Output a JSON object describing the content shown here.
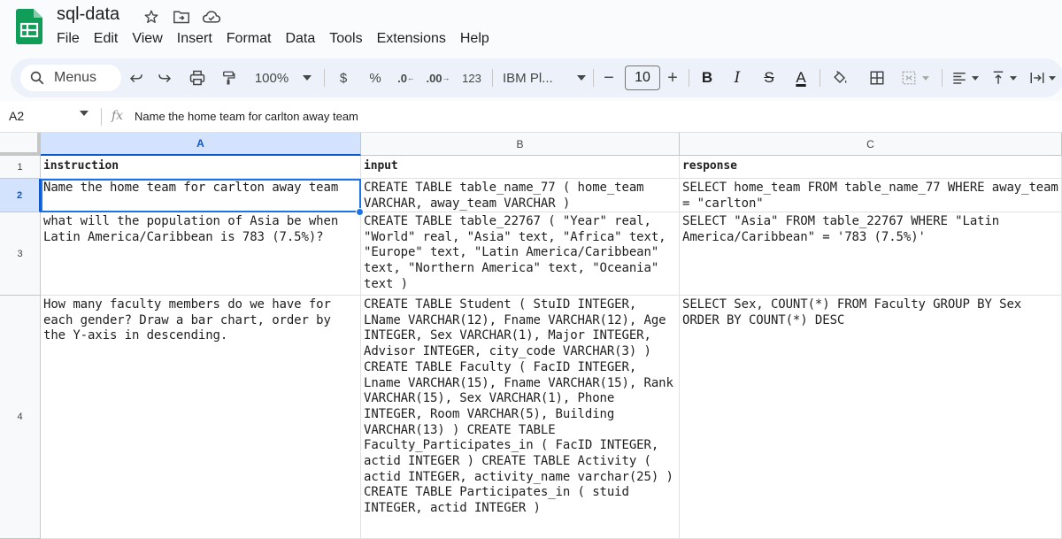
{
  "app": {
    "doc_title": "sql-data",
    "title_icons": [
      "star-icon",
      "move-to-folder-icon",
      "cloud-saved-icon"
    ],
    "menu": [
      "File",
      "Edit",
      "View",
      "Insert",
      "Format",
      "Data",
      "Tools",
      "Extensions",
      "Help"
    ]
  },
  "toolbar": {
    "menus_label": "Menus",
    "zoom": "100%",
    "currency": "$",
    "percent": "%",
    "decrease_decimal": ".0",
    "increase_decimal": ".00",
    "number_format": "123",
    "font_name": "IBM Pl...",
    "font_size_minus": "−",
    "font_size": "10",
    "font_size_plus": "+",
    "bold": "B",
    "italic": "I",
    "strikethrough": "S",
    "text_color": "A"
  },
  "formula_bar": {
    "cell_ref": "A2",
    "fx": "fx",
    "content": "Name the home team for carlton away team"
  },
  "grid": {
    "columns": [
      "A",
      "B",
      "C"
    ],
    "row_numbers": [
      "1",
      "2",
      "3",
      "4"
    ],
    "header_row": [
      "instruction",
      "input",
      "response"
    ],
    "rows": [
      {
        "instruction": "Name the home team for carlton away team",
        "input": "CREATE TABLE table_name_77 ( home_team VARCHAR, away_team VARCHAR )",
        "response": "SELECT home_team FROM table_name_77 WHERE away_team = \"carlton\""
      },
      {
        "instruction": "what will the population of Asia be when Latin America/Caribbean is 783 (7.5%)?",
        "input": "CREATE TABLE table_22767 ( \"Year\" real, \"World\" real, \"Asia\" text, \"Africa\" text, \"Europe\" text, \"Latin America/Caribbean\" text, \"Northern America\" text, \"Oceania\" text )",
        "response": "SELECT \"Asia\" FROM table_22767 WHERE \"Latin America/Caribbean\" = '783 (7.5%)'"
      },
      {
        "instruction": "How many faculty members do we have for each gender? Draw a bar chart, order by the Y-axis in descending.",
        "input": "CREATE TABLE Student ( StuID INTEGER, LName VARCHAR(12), Fname VARCHAR(12), Age INTEGER, Sex VARCHAR(1), Major INTEGER, Advisor INTEGER, city_code VARCHAR(3) ) CREATE TABLE Faculty ( FacID INTEGER, Lname VARCHAR(15), Fname VARCHAR(15), Rank VARCHAR(15), Sex VARCHAR(1), Phone INTEGER, Room VARCHAR(5), Building VARCHAR(13) ) CREATE TABLE Faculty_Participates_in ( FacID INTEGER, actid INTEGER ) CREATE TABLE Activity ( actid INTEGER, activity_name varchar(25) ) CREATE TABLE Participates_in ( stuid INTEGER, actid INTEGER )",
        "response": "SELECT Sex, COUNT(*) FROM Faculty GROUP BY Sex ORDER BY COUNT(*) DESC"
      }
    ]
  },
  "colors": {
    "accent": "#1a73e8",
    "selected_header": "#d3e3fd",
    "toolbar_bg": "#edf2fa",
    "sheets_green": "#0f9d58"
  }
}
